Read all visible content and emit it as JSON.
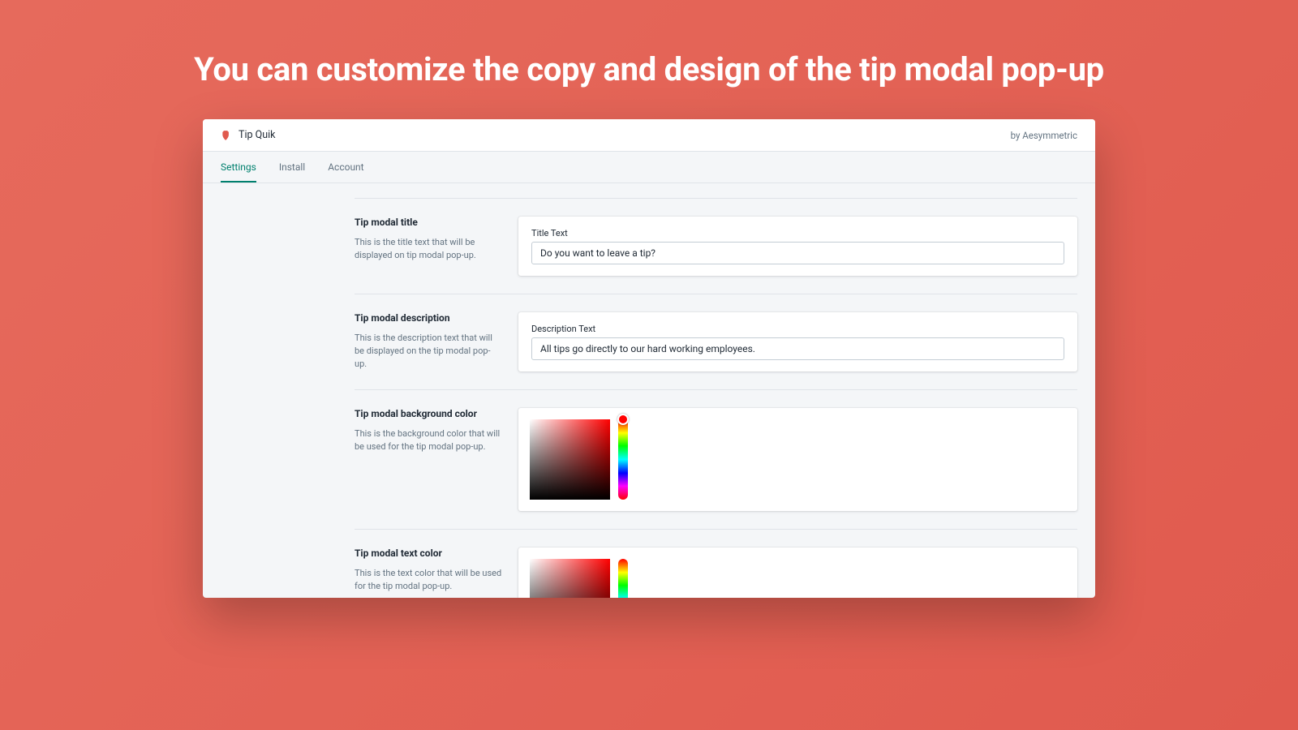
{
  "hero": {
    "title": "You can customize the copy and design of the tip modal pop-up"
  },
  "header": {
    "app_name": "Tip Quik",
    "by_line": "by Aesymmetric"
  },
  "tabs": {
    "items": [
      {
        "label": "Settings",
        "active": true
      },
      {
        "label": "Install",
        "active": false
      },
      {
        "label": "Account",
        "active": false
      }
    ]
  },
  "sections": {
    "title": {
      "heading": "Tip modal title",
      "desc": "This is the title text that will be displayed on tip modal pop-up.",
      "field_label": "Title Text",
      "value": "Do you want to leave a tip?"
    },
    "description": {
      "heading": "Tip modal description",
      "desc": "This is the description text that will be displayed on the tip modal pop-up.",
      "field_label": "Description Text",
      "value": "All tips go directly to our hard working employees."
    },
    "bg_color": {
      "heading": "Tip modal background color",
      "desc": "This is the background color that will be used for the tip modal pop-up.",
      "selected_hue": "#ff0000"
    },
    "text_color": {
      "heading": "Tip modal text color",
      "desc": "This is the text color that will be used for the tip modal pop-up.",
      "selected_hue": "#ff0000"
    }
  }
}
